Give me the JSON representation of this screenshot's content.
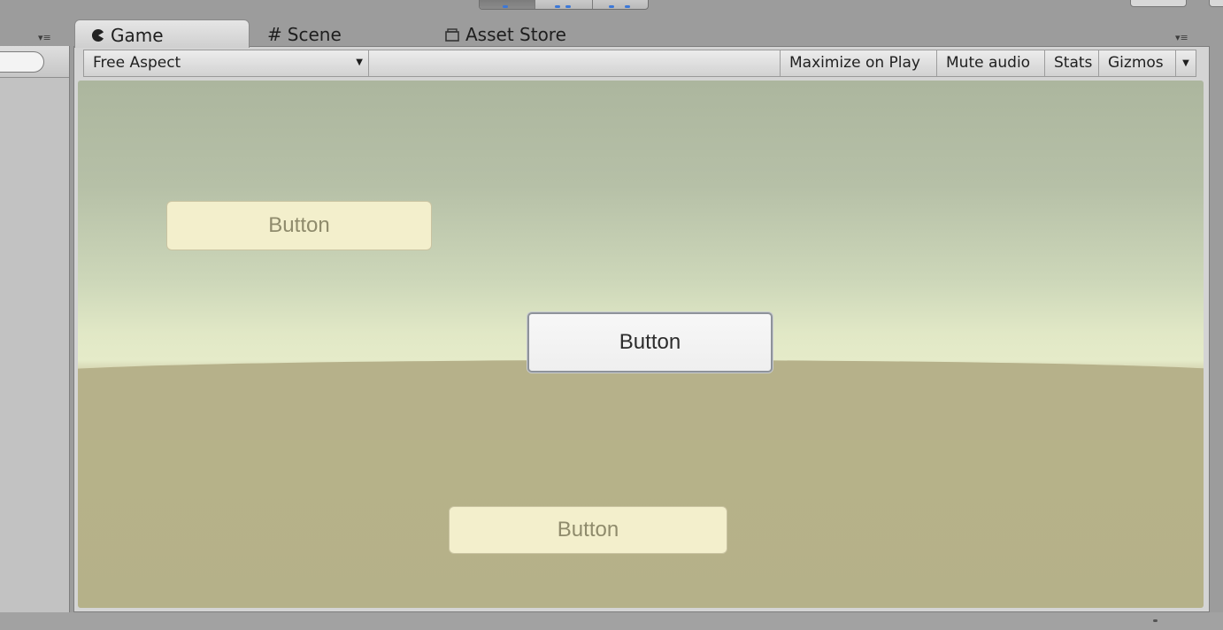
{
  "tabs": [
    {
      "label": "Game",
      "icon": "pacman-icon",
      "active": true
    },
    {
      "label": "Scene",
      "icon": "grid-icon",
      "active": false
    },
    {
      "label": "Asset Store",
      "icon": "bag-icon",
      "active": false
    }
  ],
  "game_toolbar": {
    "aspect": "Free Aspect",
    "maximize": "Maximize on Play",
    "mute": "Mute audio",
    "stats": "Stats",
    "gizmos": "Gizmos"
  },
  "game_view": {
    "buttons": [
      {
        "label": "Button",
        "state": "faded"
      },
      {
        "label": "Button",
        "state": "focused"
      },
      {
        "label": "Button",
        "state": "faded"
      }
    ]
  },
  "colors": {
    "sky_top": "#acb69e",
    "horizon": "#e5ebc9",
    "ground": "#b5b189",
    "button_fill": "#f3efcc",
    "accent_blue": "#3c78d8"
  }
}
